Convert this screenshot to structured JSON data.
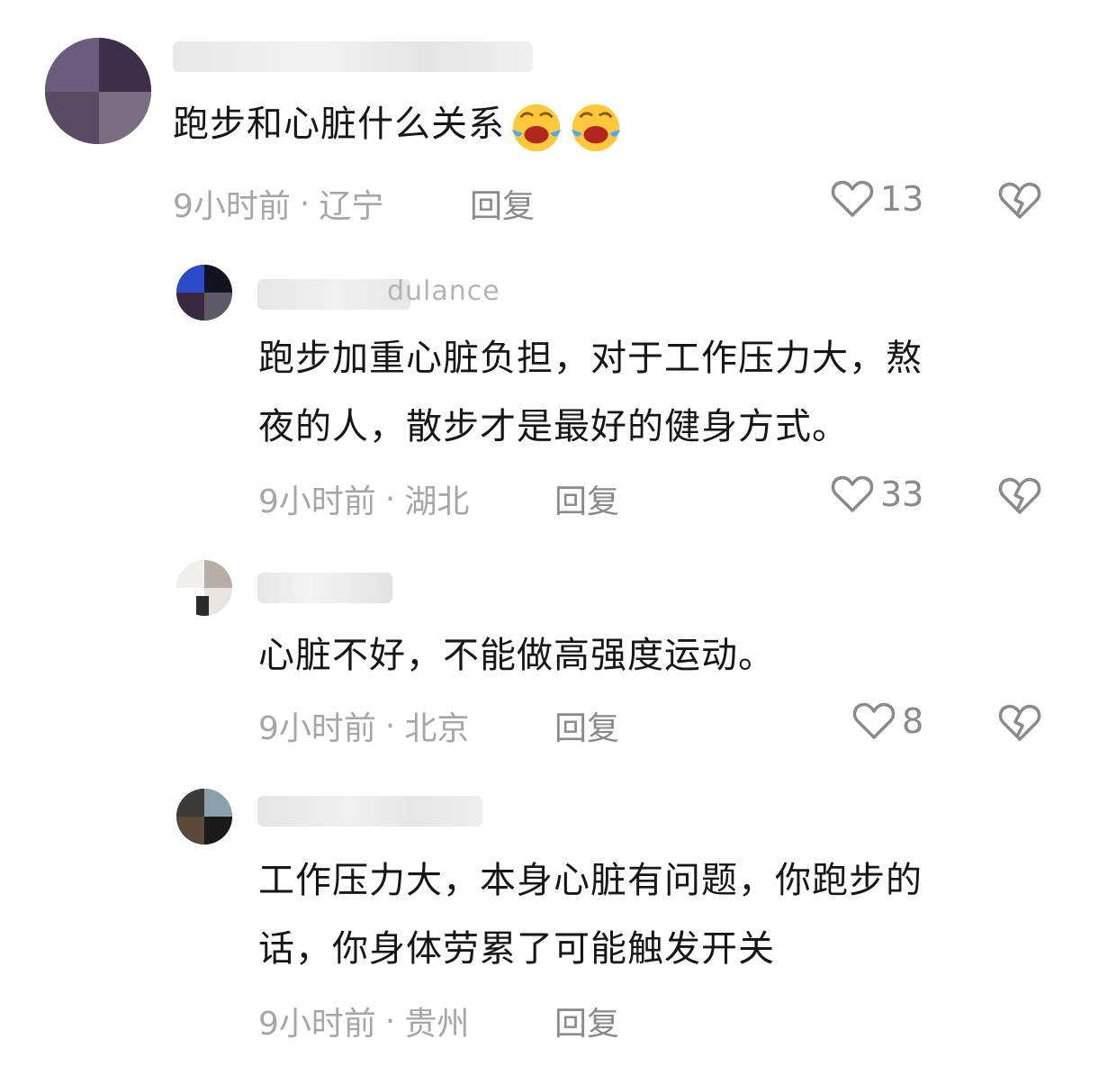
{
  "comments": [
    {
      "text": "跑步和心脏什么关系",
      "time": "9小时前",
      "location": "辽宁",
      "reply_label": "回复",
      "likes": "13",
      "emoji_count": 2,
      "emoji": "crying-laughing"
    },
    {
      "username_fragment": "dulance",
      "text": "跑步加重心脏负担，对于工作压力大，熬\n夜的人，散步才是最好的健身方式。",
      "time": "9小时前",
      "location": "湖北",
      "reply_label": "回复",
      "likes": "33"
    },
    {
      "text": "心脏不好，不能做高强度运动。",
      "time": "9小时前",
      "location": "北京",
      "reply_label": "回复",
      "likes": "8"
    },
    {
      "text": "工作压力大，本身心脏有问题，你跑步的\n话，你身体劳累了可能触发开关",
      "time": "9小时前",
      "location": "贵州",
      "reply_label": "回复"
    }
  ],
  "separator": "·",
  "colors": {
    "text": "#161616",
    "meta": "#a6a6a6",
    "icon": "#8a8a8a",
    "emoji_face": "#ffc83d"
  }
}
